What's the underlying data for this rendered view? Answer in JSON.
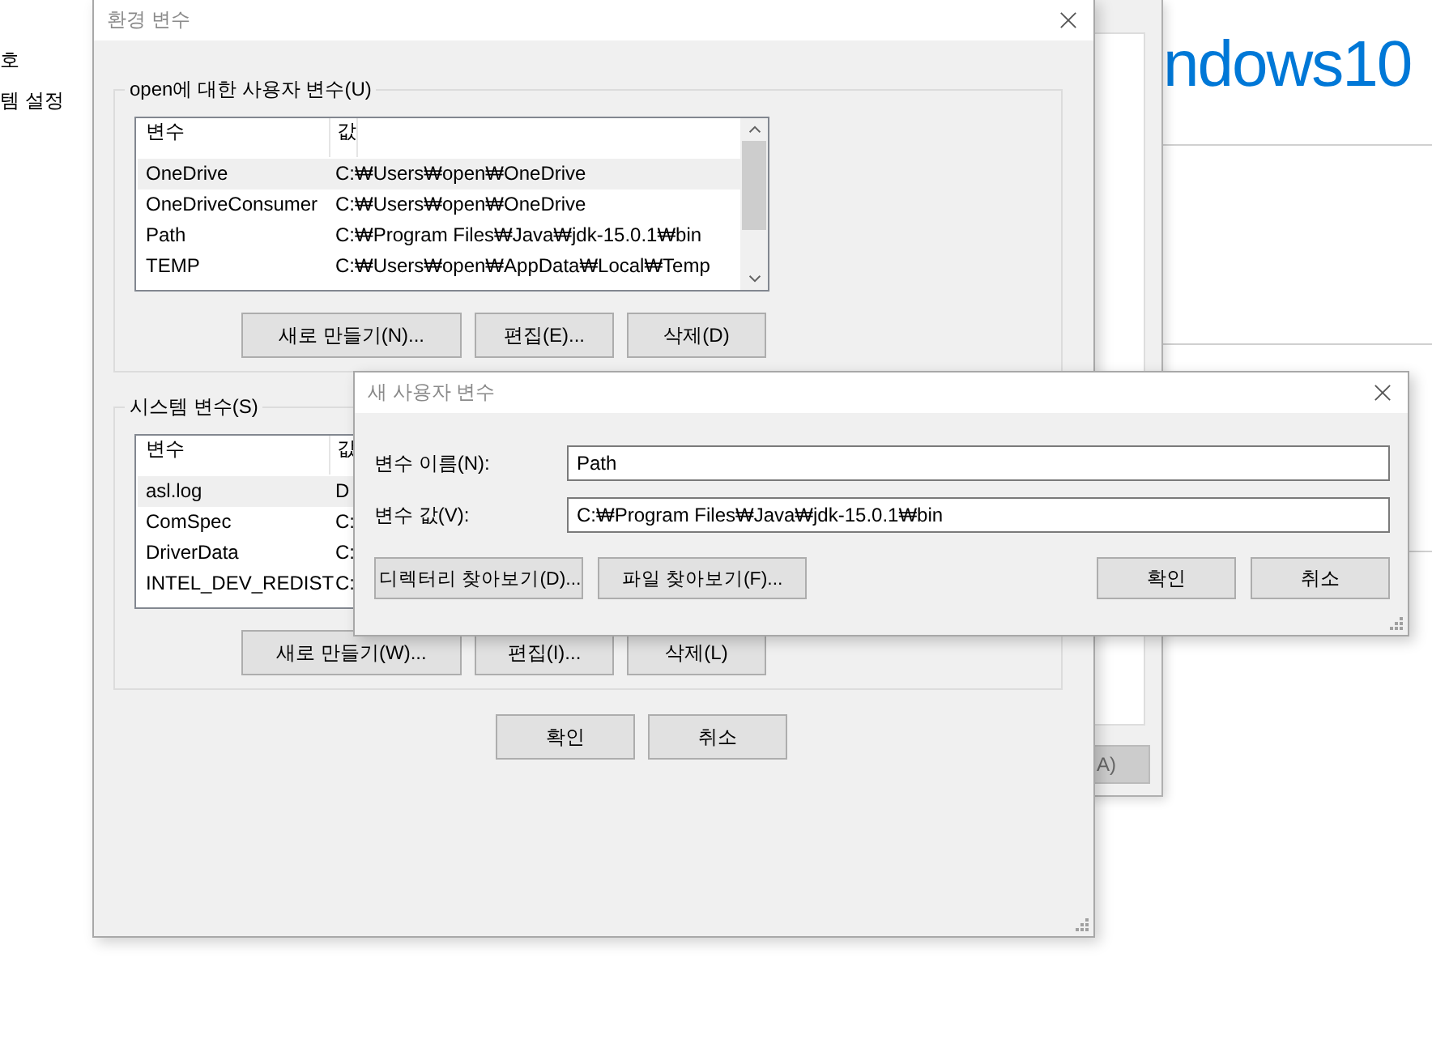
{
  "background_window": {
    "lines": [
      "호",
      "템 설정"
    ]
  },
  "system_window": {
    "logo_text": "ndows10",
    "apply_button": {
      "label": "A)",
      "disabled": true
    }
  },
  "env_dialog": {
    "title": "환경 변수",
    "groups": [
      {
        "label": "open에 대한 사용자 변수(U)",
        "columns": [
          "변수",
          "값"
        ],
        "scrollbar": true,
        "rows": [
          {
            "name": "OneDrive",
            "value": "C:₩Users₩open₩OneDrive",
            "selected": true
          },
          {
            "name": "OneDriveConsumer",
            "value": "C:₩Users₩open₩OneDrive",
            "selected": false
          },
          {
            "name": "Path",
            "value": "C:₩Program Files₩Java₩jdk-15.0.1₩bin",
            "selected": false
          },
          {
            "name": "TEMP",
            "value": "C:₩Users₩open₩AppData₩Local₩Temp",
            "selected": false
          }
        ],
        "buttons": [
          "새로 만들기(N)...",
          "편집(E)...",
          "삭제(D)"
        ]
      },
      {
        "label": "시스템 변수(S)",
        "columns": [
          "변수",
          "값"
        ],
        "scrollbar": false,
        "rows": [
          {
            "name": "asl.log",
            "value": "D",
            "selected": true
          },
          {
            "name": "ComSpec",
            "value": "C:",
            "selected": false
          },
          {
            "name": "DriverData",
            "value": "C:",
            "selected": false
          },
          {
            "name": "INTEL_DEV_REDIST",
            "value": "C:",
            "selected": false
          }
        ],
        "buttons": [
          "새로 만들기(W)...",
          "편집(I)...",
          "삭제(L)"
        ]
      }
    ],
    "buttons": [
      "확인",
      "취소"
    ]
  },
  "new_var_dialog": {
    "title": "새 사용자 변수",
    "fields": [
      {
        "label": "변수 이름(N):",
        "value": "Path"
      },
      {
        "label": "변수 값(V):",
        "value": "C:₩Program Files₩Java₩jdk-15.0.1₩bin"
      }
    ],
    "browse_buttons": [
      "디렉터리 찾아보기(D)...",
      "파일 찾아보기(F)..."
    ],
    "buttons": [
      "확인",
      "취소"
    ]
  }
}
